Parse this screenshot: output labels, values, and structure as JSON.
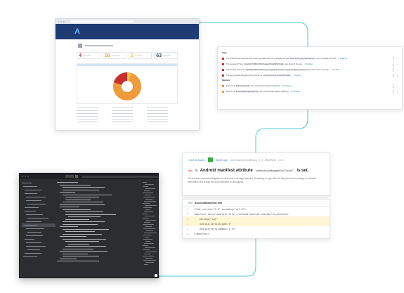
{
  "dashboard": {
    "logo": "A",
    "counts": [
      {
        "value": "4",
        "color": "#d23b3b"
      },
      {
        "value": "16",
        "color": "#f29b2a"
      },
      {
        "value": "2",
        "color": "#f5c542"
      },
      {
        "value": "63",
        "color": "#3a4a5c"
      }
    ]
  },
  "findings": {
    "high_label": "High",
    "medium_label": "Medium",
    "high": [
      {
        "text": "The Android SSL documentation warning states that the cryptographic type ",
        "code": "java.security.KeyStoreActivity",
        "rest": " must no longer be used.",
        "badge": "2 Findings"
      },
      {
        "text": "The Google API key ",
        "code": "AIzaSyC7mBKH7Xh1R-qqwe7NdqdMNsYAHE",
        "rest": " was found in the app.",
        "badge": "1 Finding"
      },
      {
        "text": "The Google OAuth ID ",
        "code": "200138761664-b7l6evnfhprncqpgn0c2ebh0hrm.apps.googleusercontent.com",
        "rest": " was found in the app.",
        "badge": "1 Finding"
      },
      {
        "text": "The app process dangerous file access via ",
        "code": "android.content.ContentProvider",
        "rest": "",
        "badge": "1 Finding"
      }
    ],
    "medium": [
      {
        "text": "Exports of ",
        "code": "IBActivityActivity",
        "rest": " are not protected against hijacking",
        "badge": "10 Findings"
      },
      {
        "text": "Exports of ",
        "code": "FirebaseMessagingActivity",
        "rest": " are not protected against hijacking",
        "badge": "10 Findings"
      }
    ]
  },
  "issue": {
    "back_link": "< See all issues",
    "app_name": "Mobile app",
    "meta": "com.example.mobileapp  ·  1.0  ·  ANDROID  ·  2.0.0",
    "severity": "High",
    "title_prefix": "Android manifest attribute",
    "title_code": "android:debuggable=\"true\"",
    "title_suffix": "is set.",
    "description": "The attribute android:debuggable is set to true in the app manifest. Releasing an app with this flag can lead to leakage of sensitive information and leaves the app vulnerable to debugging."
  },
  "snippet": {
    "file_icon": "</>",
    "file_name": "AndroidManifest.xml",
    "lines": [
      {
        "n": "1",
        "text": "<?xml version=\"1.0\" encoding=\"utf-8\"?>"
      },
      {
        "n": "2",
        "text": "<manifest xmlns:android=\"http://schemas.android.com/apk/res/android\""
      },
      {
        "n": "3",
        "text": "    package=\"sdj\""
      },
      {
        "n": "4",
        "text": "    android:versionCode=\"1\""
      },
      {
        "n": "5",
        "text": "    android:versionName=\"1.0\">"
      },
      {
        "n": "6",
        "text": "</manifest>"
      }
    ]
  }
}
